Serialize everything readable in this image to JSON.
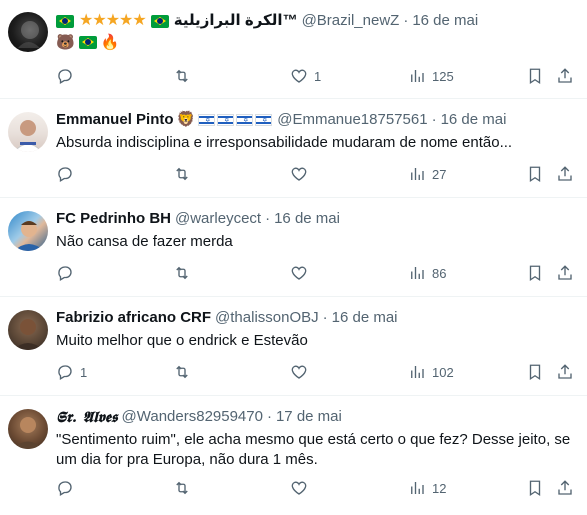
{
  "replies": [
    {
      "name_prefix_emoji": "🇧🇷",
      "name_stars": "★★★★★",
      "name": "الكرة البرازيلية™",
      "handle": "@Brazil_newZ",
      "date": "16 de mai",
      "emoji_line": [
        "🐻",
        "🇧🇷",
        "🔥"
      ],
      "replies": "",
      "retweets": "",
      "likes": "1",
      "views": "125"
    },
    {
      "name": "Emmanuel Pinto",
      "name_badge_emoji": "🦁",
      "handle": "@Emmanue18757561",
      "date": "16 de mai",
      "text": "Absurda indisciplina e irresponsabilidade mudaram de nome então...",
      "replies": "",
      "retweets": "",
      "likes": "",
      "views": "27"
    },
    {
      "name": "FC Pedrinho BH",
      "handle": "@warleycect",
      "date": "16 de mai",
      "text": "Não cansa de fazer merda",
      "replies": "",
      "retweets": "",
      "likes": "",
      "views": "86"
    },
    {
      "name": "Fabrizio africano CRF",
      "handle": "@thalissonOBJ",
      "date": "16 de mai",
      "text": "Muito melhor que o endrick e Estevão",
      "replies": "1",
      "retweets": "",
      "likes": "",
      "views": "102"
    },
    {
      "name": "𝕾𝖗. 𝕬𝖑𝖛𝖊𝖘",
      "handle": "@Wanders82959470",
      "date": "17 de mai",
      "text": "\"Sentimento ruim\", ele acha mesmo que está certo o que fez? Desse jeito, se um dia for pra Europa, não dura 1 mês.",
      "replies": "",
      "retweets": "",
      "likes": "",
      "views": "12"
    }
  ],
  "icons": {
    "reply": "reply-icon",
    "retweet": "retweet-icon",
    "like": "heart-icon",
    "views": "views-icon",
    "bookmark": "bookmark-icon",
    "share": "share-icon"
  },
  "colors": {
    "text": "#0f1419",
    "muted": "#536471",
    "divider": "#eff3f4",
    "star": "#f5a623"
  }
}
